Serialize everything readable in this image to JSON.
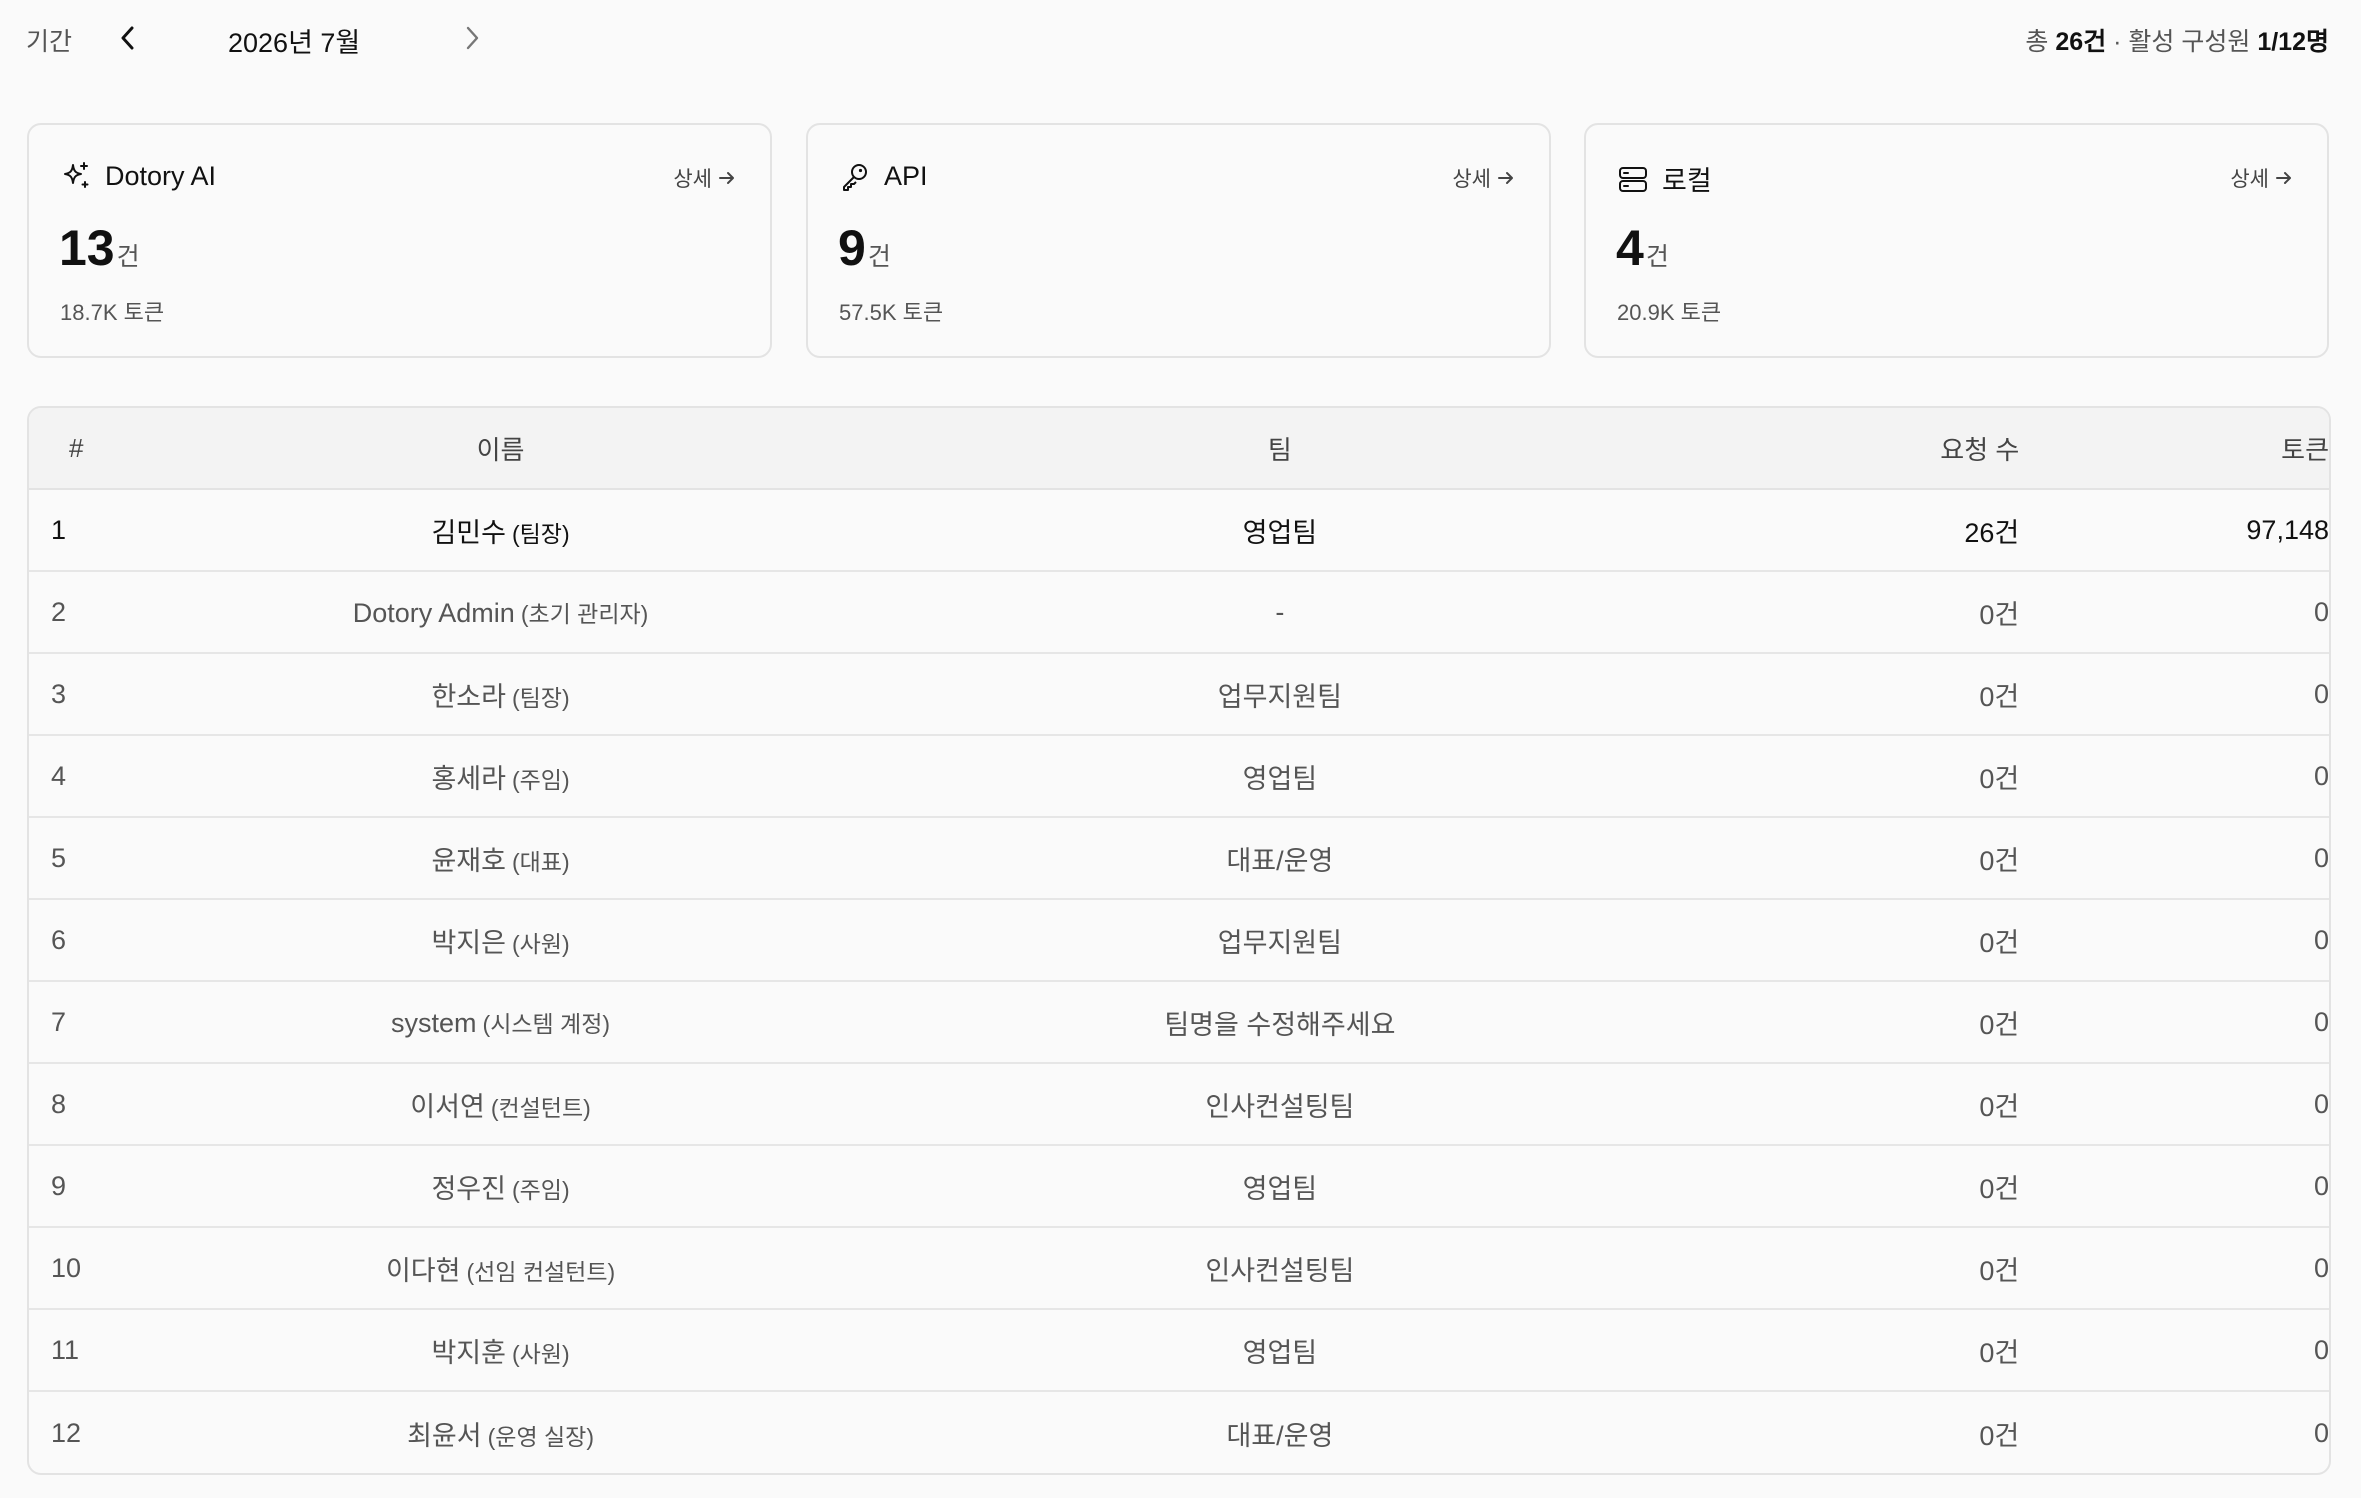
{
  "topbar": {
    "period_label": "기간",
    "period_value": "2026년 7월",
    "summary_prefix": "총",
    "summary_total": "26건",
    "summary_mid": "· 활성 구성원",
    "summary_active": "1/12명",
    "prev_icon": "chevron-left-icon",
    "next_icon": "chevron-right-icon"
  },
  "cards": [
    {
      "icon": "sparkles-icon",
      "title": "Dotory AI",
      "detail": "상세",
      "count": "13",
      "unit": "건",
      "tokens": "18.7K 토큰"
    },
    {
      "icon": "key-icon",
      "title": "API",
      "detail": "상세",
      "count": "9",
      "unit": "건",
      "tokens": "57.5K 토큰"
    },
    {
      "icon": "server-icon",
      "title": "로컬",
      "detail": "상세",
      "count": "4",
      "unit": "건",
      "tokens": "20.9K 토큰"
    }
  ],
  "table": {
    "headers": {
      "num": "#",
      "name": "이름",
      "team": "팀",
      "requests": "요청 수",
      "tokens": "토큰"
    },
    "rows": [
      {
        "num": "1",
        "name": "김민수",
        "role": "(팀장)",
        "team": "영업팀",
        "requests": "26건",
        "tokens": "97,148"
      },
      {
        "num": "2",
        "name": "Dotory Admin",
        "role": "(초기 관리자)",
        "team": "-",
        "requests": "0건",
        "tokens": "0"
      },
      {
        "num": "3",
        "name": "한소라",
        "role": "(팀장)",
        "team": "업무지원팀",
        "requests": "0건",
        "tokens": "0"
      },
      {
        "num": "4",
        "name": "홍세라",
        "role": "(주임)",
        "team": "영업팀",
        "requests": "0건",
        "tokens": "0"
      },
      {
        "num": "5",
        "name": "윤재호",
        "role": "(대표)",
        "team": "대표/운영",
        "requests": "0건",
        "tokens": "0"
      },
      {
        "num": "6",
        "name": "박지은",
        "role": "(사원)",
        "team": "업무지원팀",
        "requests": "0건",
        "tokens": "0"
      },
      {
        "num": "7",
        "name": "system",
        "role": "(시스템 계정)",
        "team": "팀명을 수정해주세요",
        "requests": "0건",
        "tokens": "0"
      },
      {
        "num": "8",
        "name": "이서연",
        "role": "(컨설턴트)",
        "team": "인사컨설팅팀",
        "requests": "0건",
        "tokens": "0"
      },
      {
        "num": "9",
        "name": "정우진",
        "role": "(주임)",
        "team": "영업팀",
        "requests": "0건",
        "tokens": "0"
      },
      {
        "num": "10",
        "name": "이다현",
        "role": "(선임 컨설턴트)",
        "team": "인사컨설팅팀",
        "requests": "0건",
        "tokens": "0"
      },
      {
        "num": "11",
        "name": "박지훈",
        "role": "(사원)",
        "team": "영업팀",
        "requests": "0건",
        "tokens": "0"
      },
      {
        "num": "12",
        "name": "최윤서",
        "role": "(운영 실장)",
        "team": "대표/운영",
        "requests": "0건",
        "tokens": "0"
      }
    ]
  }
}
